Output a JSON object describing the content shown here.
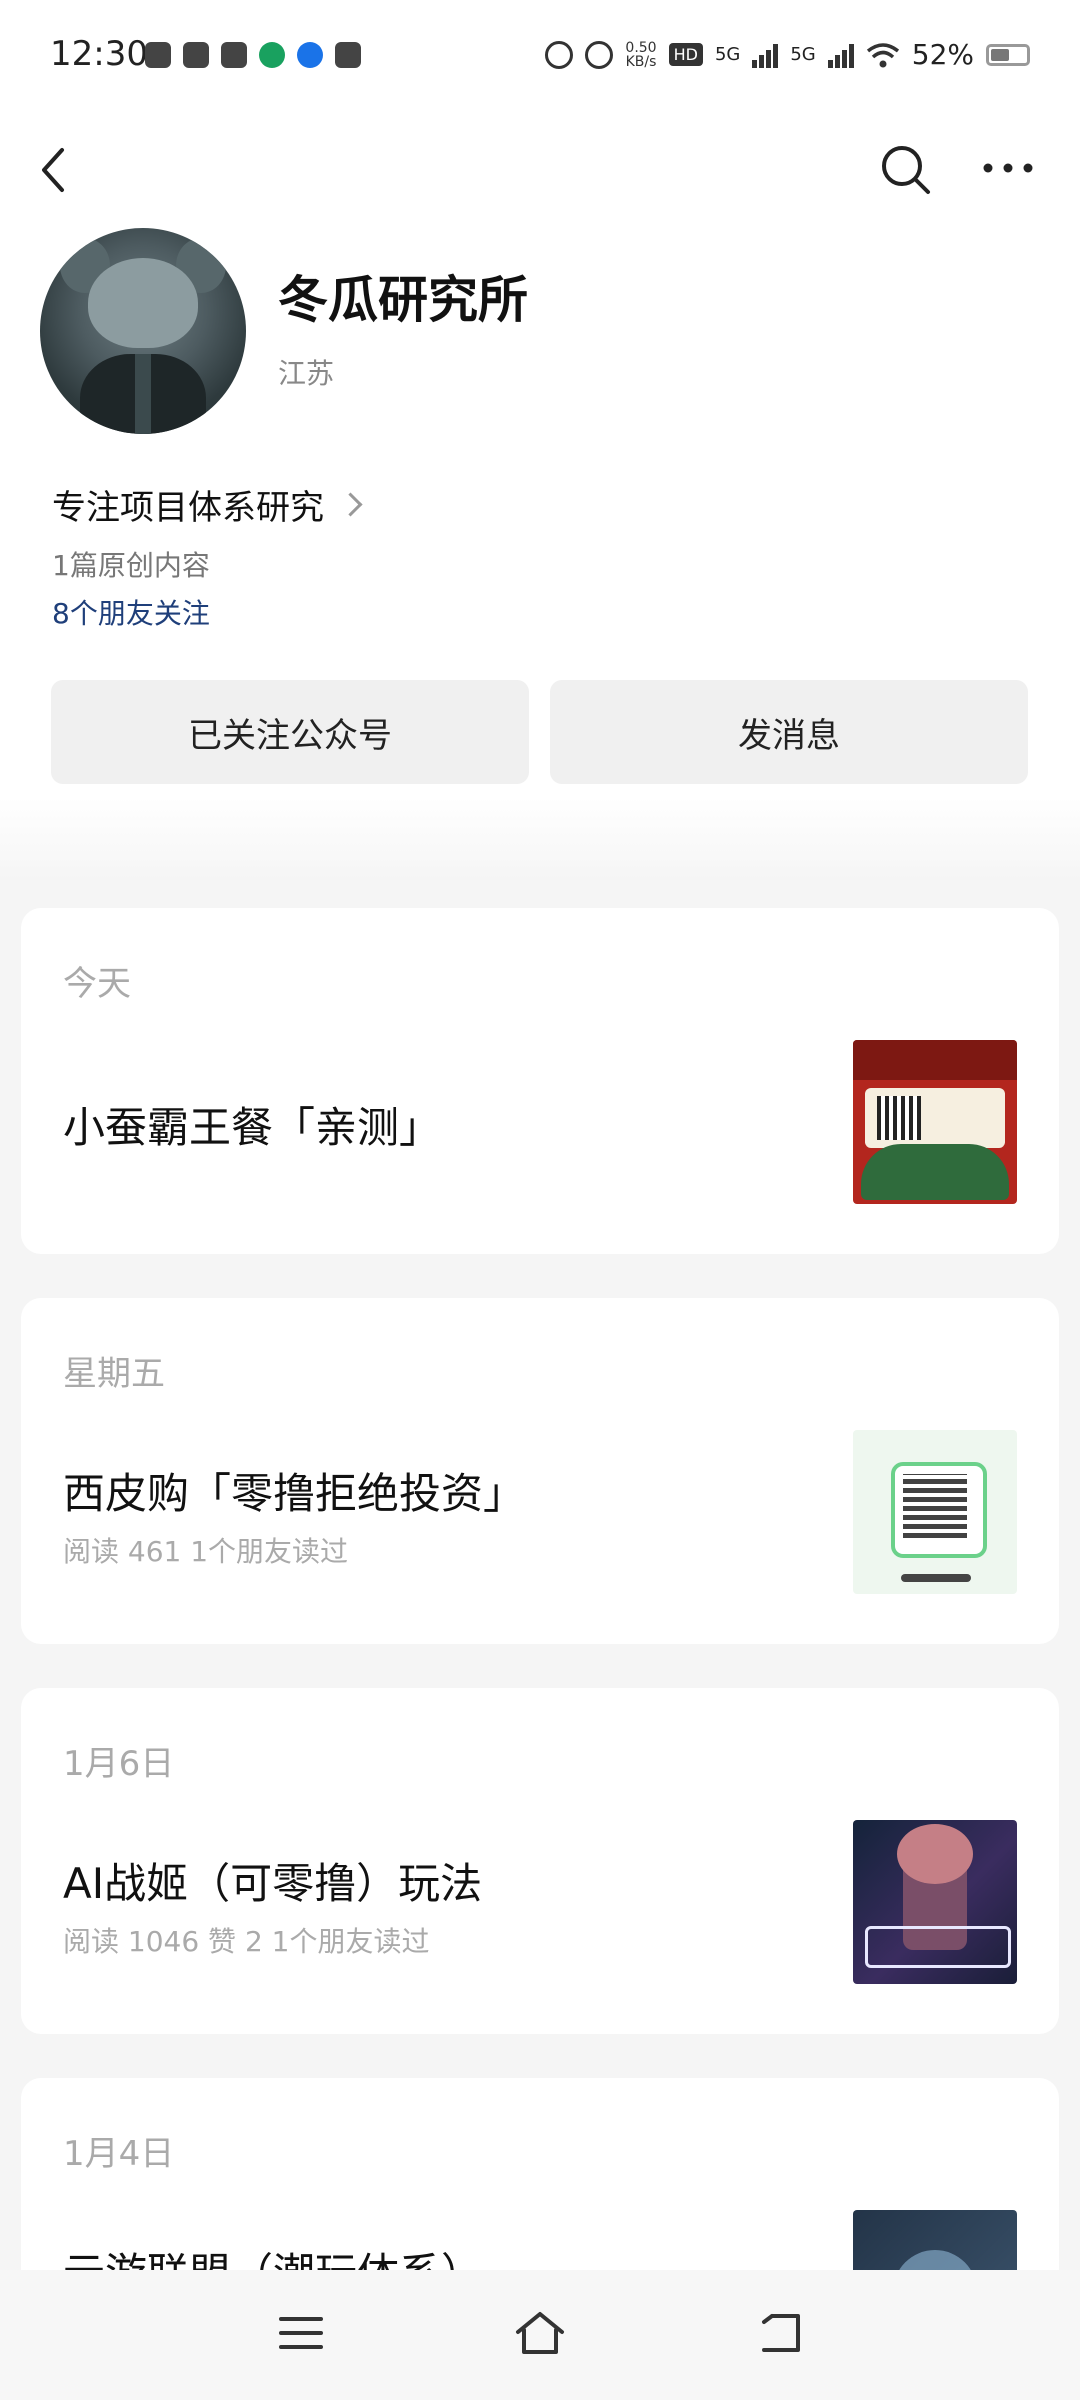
{
  "status_bar": {
    "time": "12:30",
    "net_speed": "0.50",
    "net_speed_unit": "KB/s",
    "hd": "HD",
    "sim1": "5G",
    "sim2": "5G",
    "battery": "52%"
  },
  "nav": {
    "back_icon": "chevron-left-icon",
    "search_icon": "search-icon",
    "more_icon": "more-icon"
  },
  "account": {
    "name": "冬瓜研究所",
    "location": "江苏",
    "description": "专注项目体系研究",
    "original_count": "1篇原创内容",
    "friends_following": "8个朋友关注",
    "follow_button": "已关注公众号",
    "message_button": "发消息"
  },
  "articles": [
    {
      "date": "今天",
      "title": "小蚕霸王餐「亲测」",
      "meta": ""
    },
    {
      "date": "星期五",
      "title": "西皮购「零撸拒绝投资」",
      "meta": "阅读 461   1个朋友读过"
    },
    {
      "date": "1月6日",
      "title": "AI战姬（可零撸）玩法",
      "meta": "阅读 1046   赞 2   1个朋友读过"
    },
    {
      "date": "1月4日",
      "title": "云游联盟（潮玩体系）",
      "meta": ""
    }
  ],
  "system_nav": {
    "menu_icon": "menu-icon",
    "home_icon": "home-icon",
    "back_icon": "back-icon"
  }
}
